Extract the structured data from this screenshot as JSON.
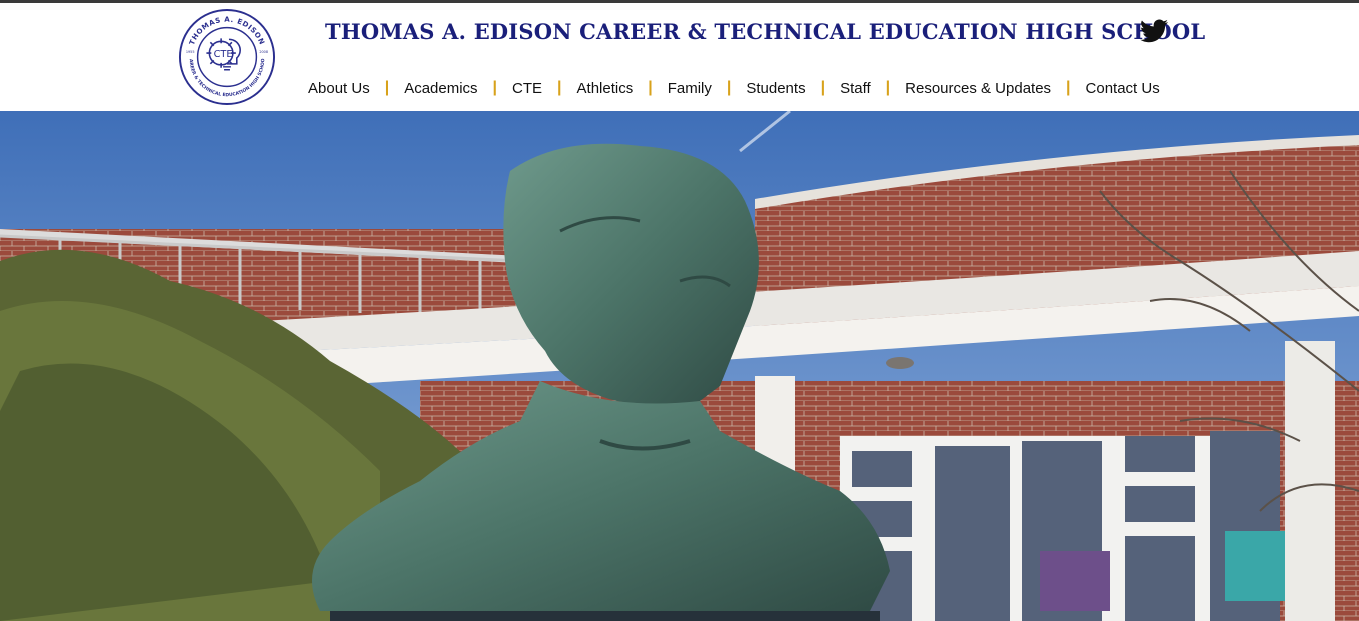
{
  "header": {
    "title": "THOMAS A. EDISON CAREER & TECHNICAL EDUCATION HIGH SCHOOL",
    "logo": {
      "ring_text_top": "THOMAS A. EDISON",
      "ring_text_bottom": "CAREER & TECHNICAL EDUCATION HIGH SCHOOL",
      "center_text": "CTE",
      "left_year": "1955",
      "right_year": "2008",
      "color": "#2b2f8f"
    },
    "social": {
      "icon": "twitter-icon"
    }
  },
  "nav": {
    "items": [
      {
        "label": "About Us"
      },
      {
        "label": "Academics"
      },
      {
        "label": "CTE"
      },
      {
        "label": "Athletics"
      },
      {
        "label": "Family"
      },
      {
        "label": "Students"
      },
      {
        "label": "Staff"
      },
      {
        "label": "Resources & Updates"
      },
      {
        "label": "Contact Us"
      }
    ],
    "separator": "|",
    "separator_color": "#d8a21b"
  },
  "hero": {
    "subject": "bronze bust in front of brick building",
    "colors": {
      "sky": "#5a87c8",
      "brick": "#9a4a3a",
      "bronze": "#4f7a6e",
      "foliage": "#5f6b3a"
    }
  }
}
